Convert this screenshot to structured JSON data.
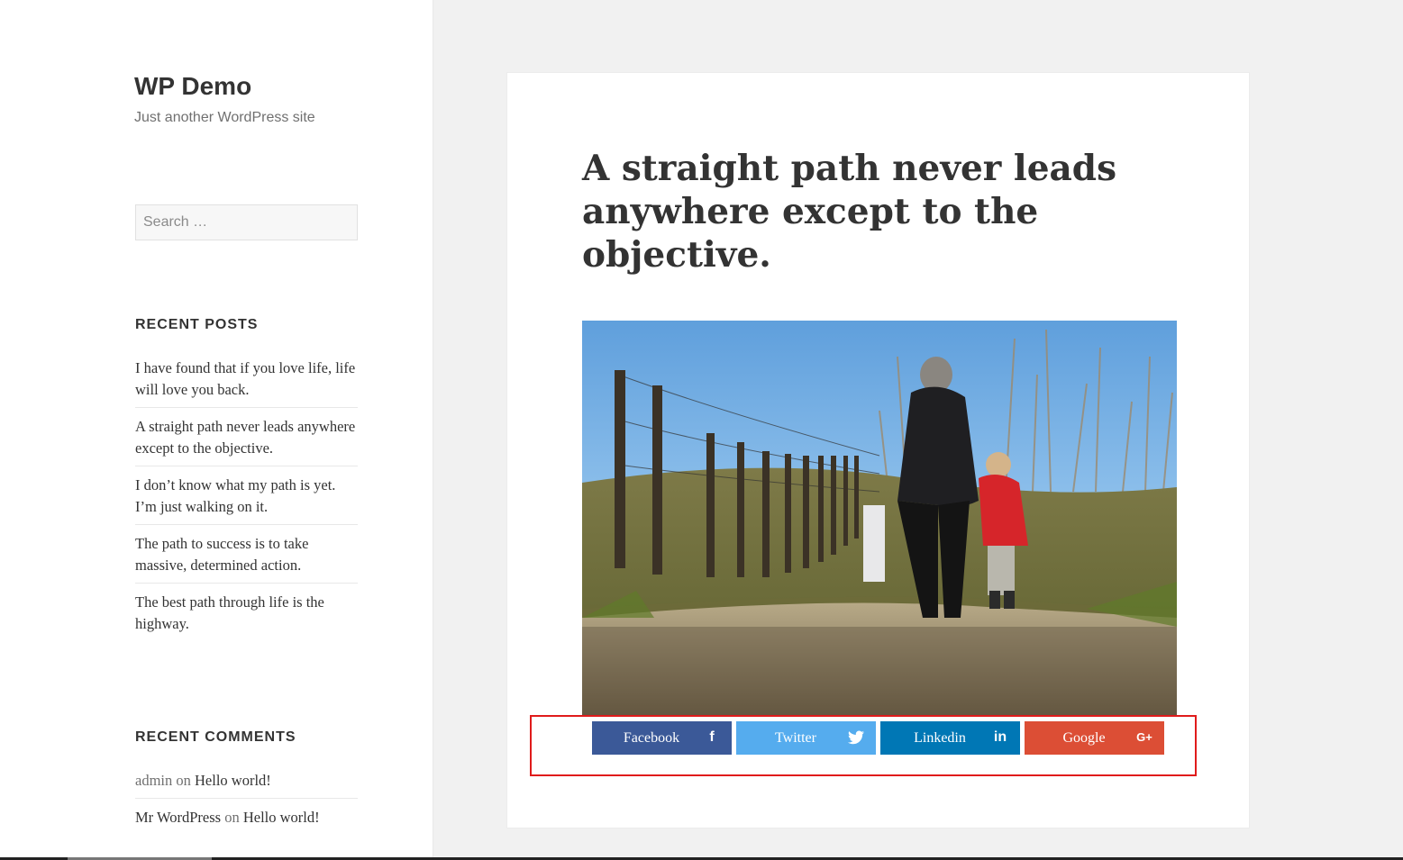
{
  "site": {
    "title": "WP Demo",
    "description": "Just another WordPress site"
  },
  "search": {
    "placeholder": "Search …"
  },
  "recent_posts": {
    "title": "RECENT POSTS",
    "items": [
      "I have found that if you love life, life will love you back.",
      "A straight path never leads anywhere except to the objective.",
      "I don’t know what my path is yet. I’m just walking on it.",
      "The path to success is to take massive, determined action.",
      "The best path through life is the highway."
    ]
  },
  "recent_comments": {
    "title": "RECENT COMMENTS",
    "items": [
      {
        "author": "admin",
        "on": "on",
        "post": "Hello world!"
      },
      {
        "author": "Mr WordPress",
        "on": "on",
        "post": "Hello world!"
      }
    ]
  },
  "article": {
    "title": "A straight path never leads anywhere except to the objective."
  },
  "share": {
    "buttons": [
      {
        "label": "Facebook",
        "icon": "facebook-icon",
        "glyph": "f",
        "color": "#3b5998"
      },
      {
        "label": "Twitter",
        "icon": "twitter-icon",
        "glyph": "🐦",
        "color": "#55acee"
      },
      {
        "label": "Linkedin",
        "icon": "linkedin-icon",
        "glyph": "in",
        "color": "#0077b5"
      },
      {
        "label": "Google",
        "icon": "google-plus-icon",
        "glyph": "G+",
        "color": "#dc4e35"
      }
    ],
    "highlight_color": "#e01b1b"
  }
}
